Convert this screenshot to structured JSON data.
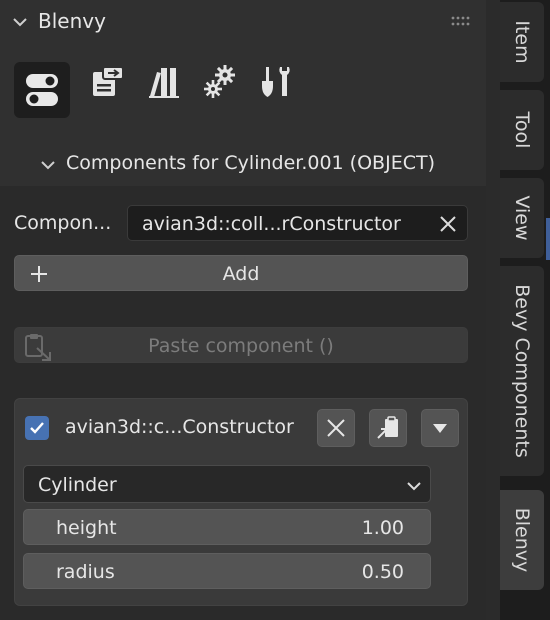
{
  "panel": {
    "title": "Blenvy",
    "tabs": [
      {
        "icon": "toggle-icon",
        "active": true
      },
      {
        "icon": "export-icon"
      },
      {
        "icon": "library-icon"
      },
      {
        "icon": "settings-gears-icon"
      },
      {
        "icon": "tools-icon"
      }
    ]
  },
  "components_section": {
    "title": "Components for Cylinder.001  (OBJECT)",
    "component_label": "Compon...",
    "component_value": "avian3d::coll...rConstructor",
    "add_label": "Add",
    "paste_label": "Paste component ()"
  },
  "component_card": {
    "name": "avian3d::c...Constructor",
    "enabled": true,
    "variant_selected": "Cylinder",
    "fields": [
      {
        "key": "height",
        "value": "1.00"
      },
      {
        "key": "radius",
        "value": "0.50"
      }
    ]
  },
  "sidebar_tabs": [
    {
      "label": "Item"
    },
    {
      "label": "Tool"
    },
    {
      "label": "View"
    },
    {
      "label": "Bevy Components"
    },
    {
      "label": "Blenvy",
      "active": true
    }
  ],
  "colors": {
    "accent_blue": "#4772b3",
    "panel_bg": "#303030",
    "button_bg": "#545454"
  }
}
